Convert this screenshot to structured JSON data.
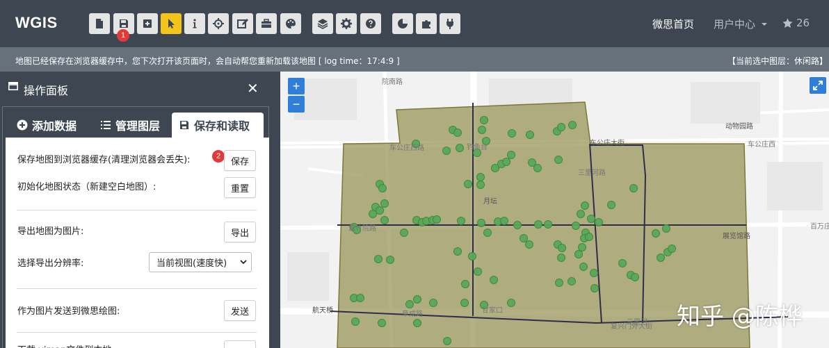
{
  "app": {
    "logo": "WGIS"
  },
  "toolbar": {
    "buttons": [
      "new-file",
      "save",
      "add",
      "select",
      "info",
      "locate",
      "edit",
      "toolbox",
      "palette",
      "layers",
      "settings",
      "help",
      "chart",
      "plugin",
      "power"
    ],
    "active": "select",
    "badge1": "1",
    "active_color": "#f3c41a"
  },
  "nav": {
    "home": "微思首页",
    "user_center": "用户中心",
    "star_count": "26"
  },
  "status": {
    "message": "地图已经保存在浏览器缓存中，您下次打开该页面时，会自动帮您重新加载该地图 [ log time：17:4:9 ]",
    "current_layer": "【当前选中图层：休闲路】"
  },
  "panel": {
    "title": "操作面板",
    "close": "✕",
    "tabs": [
      "添加数据",
      "管理图层",
      "保存和读取"
    ],
    "active_tab": "保存和读取",
    "rows": {
      "save_cache_label": "保存地图到浏览器缓存(清理浏览器会丢失):",
      "save_badge": "2",
      "save_button": "保存",
      "reset_label": "初始化地图状态（新建空白地图）:",
      "reset_button": "重置",
      "export_label": "导出地图为图片:",
      "export_button": "导出",
      "resolution_label": "选择导出分辨率:",
      "resolution_value": "当前视图(速度快)",
      "send_label": "作为图片发送到微思绘图:",
      "send_button": "发送",
      "download_label": "下载 vjmap文件到本地:"
    }
  },
  "map": {
    "zoom_in": "+",
    "zoom_out": "−",
    "labels": {
      "a": "院南路",
      "b": "车公庄大街",
      "c": "动物园路",
      "d": "车公庄西",
      "e": "车公庄西路",
      "f": "三里河路",
      "g": "展览馆路",
      "h": "百万庄",
      "i": "月坛",
      "j": "钓鱼台",
      "k": "甘家口",
      "l": "复兴门外大街",
      "m": "航天桥",
      "n": "阜成路",
      "o": "三里河",
      "p": "紫竹院路"
    },
    "watermark": "知乎 @陈桦",
    "area_fill": "#8f8a4a",
    "point_color": "#5aa85a",
    "line_color": "#2d2d4a"
  }
}
